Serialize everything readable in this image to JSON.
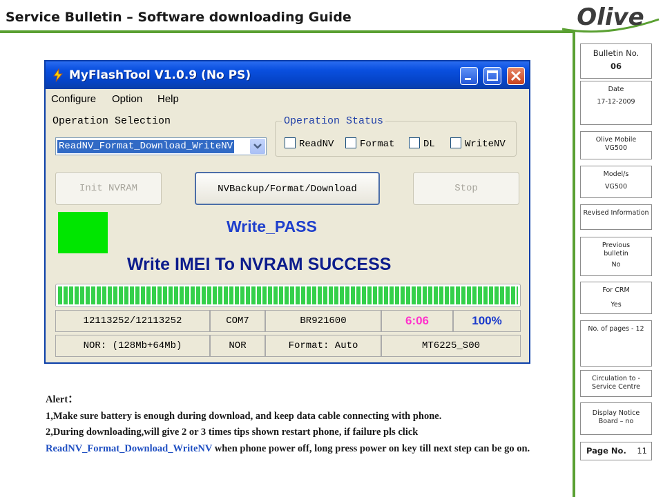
{
  "header": {
    "title": "Service Bulletin – Software downloading Guide",
    "logo_text": "Olive"
  },
  "colors": {
    "accent_green": "#5aa032",
    "xp_titlebar_blue": "#0a50e0",
    "pass_square": "#00e600",
    "progress_green": "#34d04a",
    "time_magenta": "#ff33cc",
    "percent_blue": "#1a3acc"
  },
  "sidebar": {
    "bulletin": {
      "label": "Bulletin No.",
      "value": "06"
    },
    "date": {
      "label": "Date",
      "value": "17-12-2009"
    },
    "olive_mobile": {
      "label": "Olive Mobile",
      "value": "VG500"
    },
    "models": {
      "label": "Model/s",
      "value": "VG500"
    },
    "revised": {
      "label": "Revised Information",
      "value": ""
    },
    "previous": {
      "label": "Previous bulletin",
      "value": "No"
    },
    "crm": {
      "label": "For CRM",
      "value": "Yes"
    },
    "pages": {
      "label": "No. of pages - 12",
      "value": ""
    },
    "circulation": {
      "label": "Circulation to - Service Centre",
      "value": ""
    },
    "display_notice": {
      "label": "Display Notice Board – no",
      "value": ""
    },
    "page_no": {
      "label": "Page No.",
      "value": "11"
    }
  },
  "app": {
    "title": "MyFlashTool V1.0.9 (No PS)",
    "icons": [
      "flash-tool-icon",
      "minimize-icon",
      "maximize-icon",
      "close-icon"
    ],
    "menu": [
      "Configure",
      "Option",
      "Help"
    ],
    "operation_selection_label": "Operation Selection",
    "operation_selected": "ReadNV_Format_Download_WriteNV",
    "operation_status_label": "Operation Status",
    "status_checkboxes": [
      "ReadNV",
      "Format",
      "DL",
      "WriteNV"
    ],
    "buttons": {
      "init": "Init NVRAM",
      "main": "NVBackup/Format/Download",
      "stop": "Stop"
    },
    "result_text": "Write_PASS",
    "message": "Write IMEI To NVRAM SUCCESS",
    "progress_fraction": 1.0,
    "info_row1": [
      "12113252/12113252",
      "COM7",
      "BR921600",
      "6:06",
      "100%"
    ],
    "info_row2": [
      "NOR: (128Mb+64Mb)",
      "NOR",
      "Format: Auto",
      "MT6225_S00"
    ]
  },
  "alert": {
    "heading": "Alert：",
    "line1": "1,Make sure battery is enough during download, and keep data cable connecting with phone.",
    "line2_before": "2,During downloading,will give 2 or 3 times tips shown restart phone, if failure pls click",
    "line2_keyword": "ReadNV_Format_Download_WriteNV",
    "line2_after": " when phone power off, long press power on key till next step can be go on."
  }
}
